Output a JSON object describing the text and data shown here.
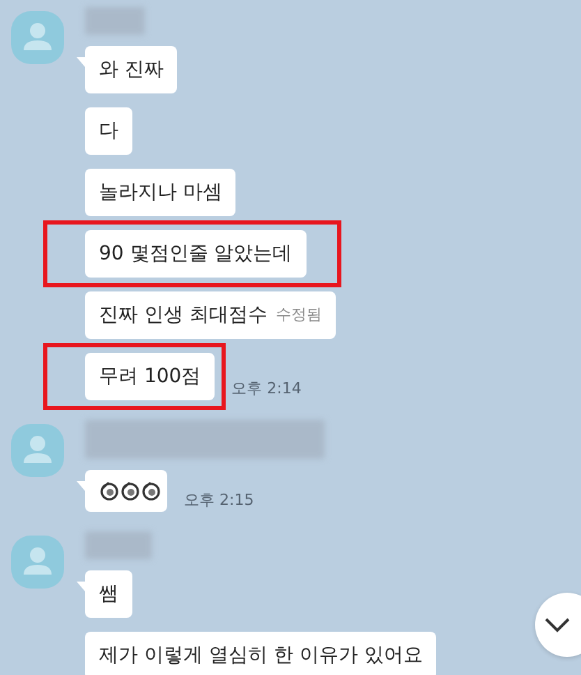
{
  "groups": [
    {
      "messages": [
        {
          "kind": "text",
          "text": "와 진짜",
          "highlighted": false
        },
        {
          "kind": "text",
          "text": "다",
          "highlighted": false
        },
        {
          "kind": "text",
          "text": "놀라지나 마셈",
          "highlighted": false
        },
        {
          "kind": "text",
          "text": "90 몇점인줄 알았는데",
          "highlighted": true
        },
        {
          "kind": "text",
          "text": "진짜 인생 최대점수",
          "edited": "수정됨",
          "highlighted": false
        },
        {
          "kind": "text",
          "text": "무려 100점",
          "time": "오후 2:14",
          "highlighted": true
        }
      ]
    },
    {
      "messages": [
        {
          "kind": "clap",
          "time": "오후 2:15",
          "highlighted": false
        }
      ]
    },
    {
      "messages": [
        {
          "kind": "text",
          "text": "쌤",
          "highlighted": false
        },
        {
          "kind": "text",
          "text": "제가 이렇게 열심히 한 이유가 있어요",
          "highlighted": false
        }
      ]
    }
  ]
}
